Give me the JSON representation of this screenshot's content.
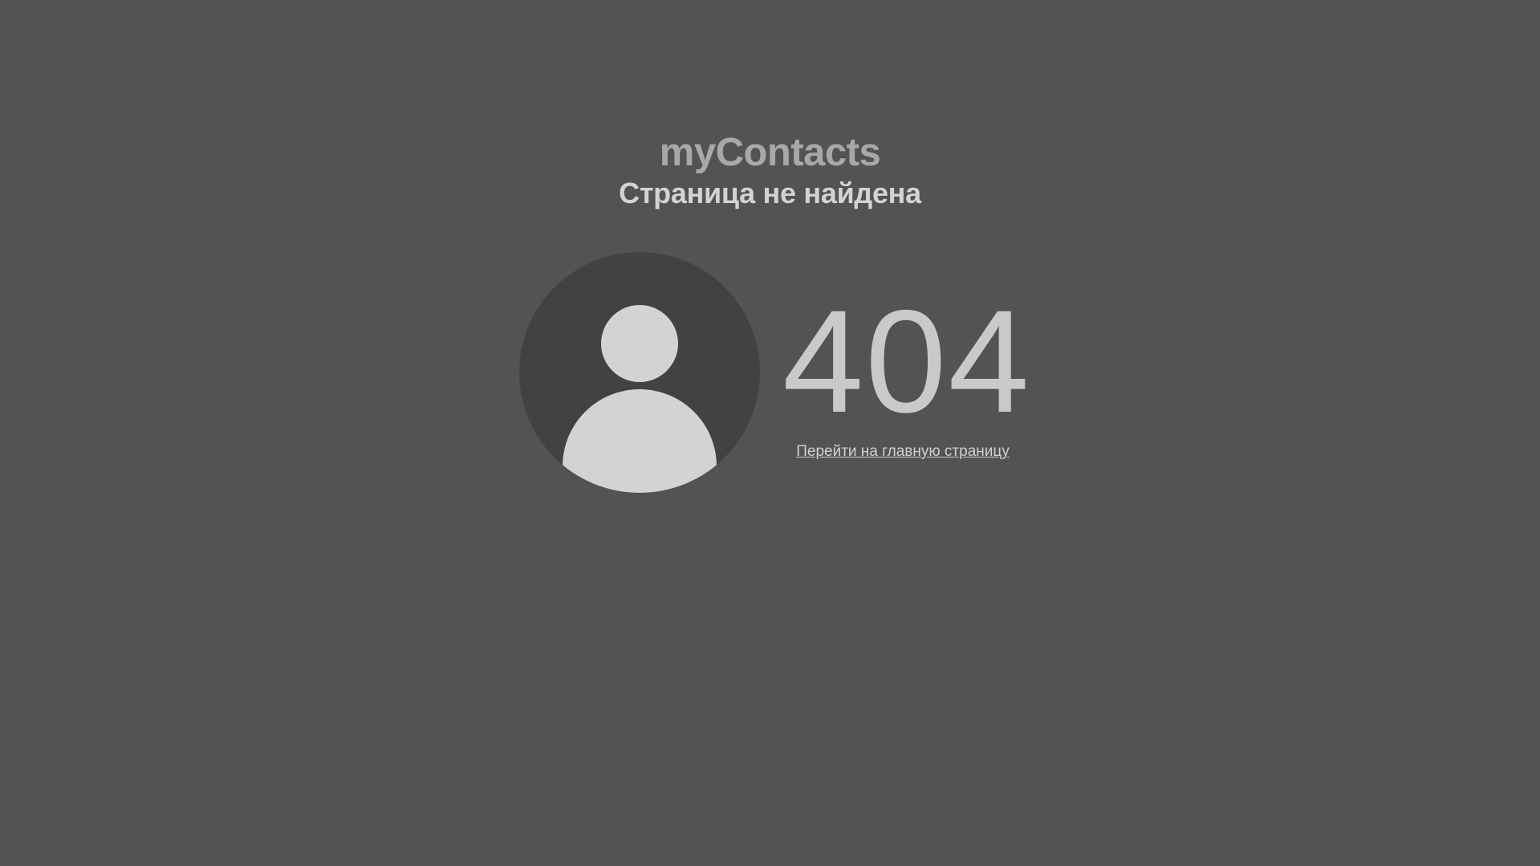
{
  "header": {
    "app_title": "myContacts",
    "page_title": "Страница не найдена"
  },
  "error": {
    "code": "404",
    "home_link_label": "Перейти на главную страницу"
  },
  "icons": {
    "avatar": "user-silhouette-icon"
  },
  "colors": {
    "background": "#535353",
    "avatar_circle": "#424242",
    "avatar_figure": "#d3d3d3",
    "app_title": "#a8a8a8",
    "page_title": "#d3d3d3",
    "error_code": "#c9c9c9",
    "link": "#d0d0d0"
  }
}
